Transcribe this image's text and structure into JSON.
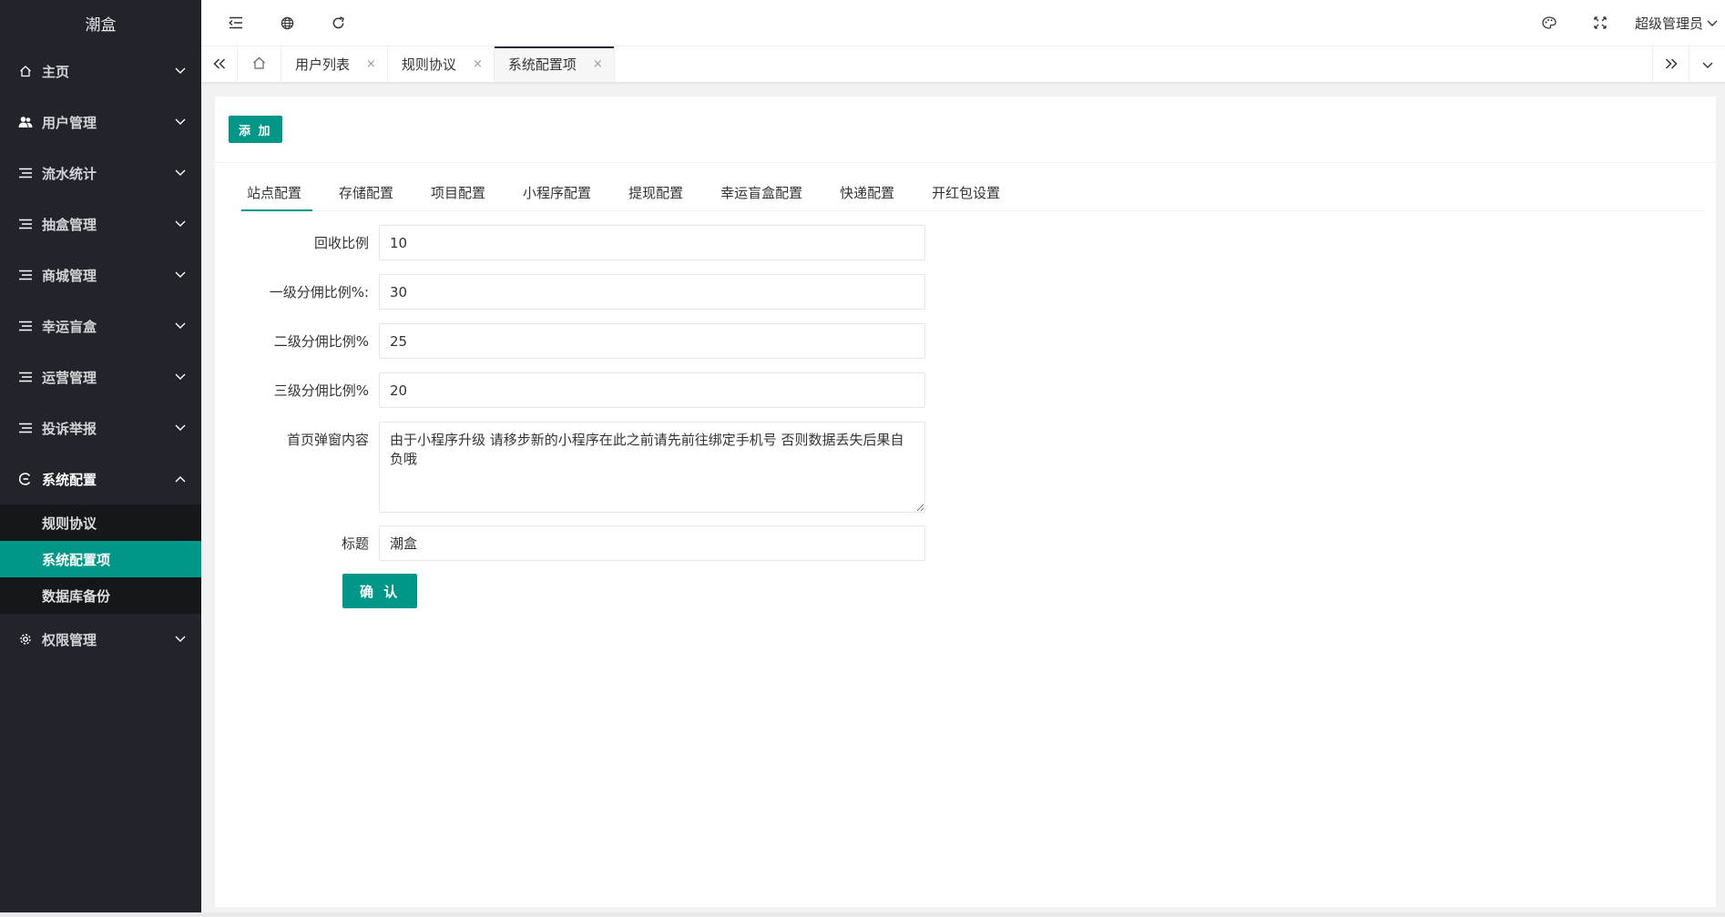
{
  "app": {
    "title": "潮盒"
  },
  "sidebar": {
    "items": [
      {
        "label": "主页",
        "icon": "home-icon"
      },
      {
        "label": "用户管理",
        "icon": "users-icon"
      },
      {
        "label": "流水统计",
        "icon": "list-icon"
      },
      {
        "label": "抽盒管理",
        "icon": "list-icon"
      },
      {
        "label": "商城管理",
        "icon": "list-icon"
      },
      {
        "label": "幸运盲盒",
        "icon": "list-icon"
      },
      {
        "label": "运营管理",
        "icon": "list-icon"
      },
      {
        "label": "投诉举报",
        "icon": "list-icon"
      },
      {
        "label": "系统配置",
        "icon": "settings-icon",
        "open": true,
        "children": [
          {
            "label": "规则协议"
          },
          {
            "label": "系统配置项",
            "active": true
          },
          {
            "label": "数据库备份"
          }
        ]
      },
      {
        "label": "权限管理",
        "icon": "gear-icon"
      }
    ]
  },
  "header": {
    "user_name": "超级管理员"
  },
  "tabsbar": {
    "tabs": [
      {
        "label": "用户列表"
      },
      {
        "label": "规则协议"
      },
      {
        "label": "系统配置项",
        "active": true
      }
    ],
    "close_glyph": "×"
  },
  "main": {
    "add_button": "添 加",
    "config_tabs": [
      "站点配置",
      "存储配置",
      "项目配置",
      "小程序配置",
      "提现配置",
      "幸运盲盒配置",
      "快递配置",
      "开红包设置"
    ],
    "active_tab": 0,
    "fields": {
      "recycle_ratio": {
        "label": "回收比例",
        "value": "10"
      },
      "level1": {
        "label": "一级分佣比例%:",
        "value": "30"
      },
      "level2": {
        "label": "二级分佣比例%",
        "value": "25"
      },
      "level3": {
        "label": "三级分佣比例%",
        "value": "20"
      },
      "popup": {
        "label": "首页弹窗内容",
        "value": "由于小程序升级 请移步新的小程序在此之前请先前往绑定手机号 否则数据丢失后果自负哦"
      },
      "title": {
        "label": "标题",
        "value": "潮盒"
      }
    },
    "confirm_button": "确 认"
  },
  "colors": {
    "accent": "#009688",
    "sidebar_bg": "#21252b",
    "submenu_bg": "#15181b"
  }
}
